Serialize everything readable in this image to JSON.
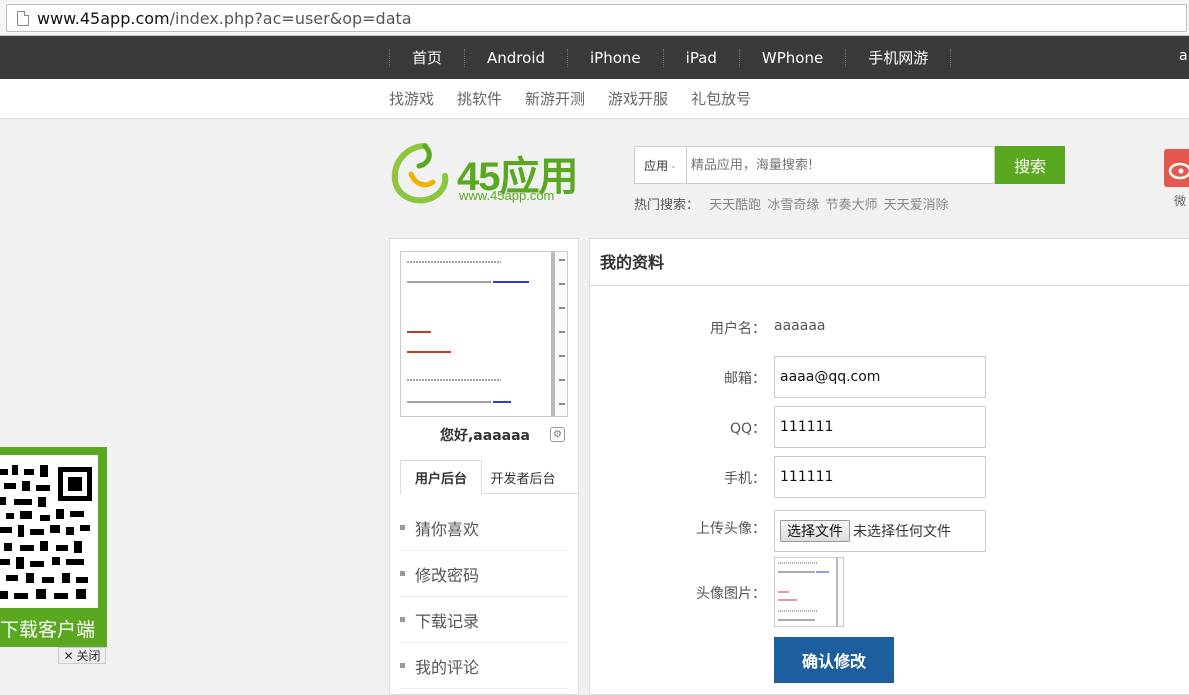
{
  "browser": {
    "url_host": "www.45app.com",
    "url_path": "/index.php?ac=user&op=data"
  },
  "top_nav": {
    "items": [
      "首页",
      "Android",
      "iPhone",
      "iPad",
      "WPhone",
      "手机网游"
    ],
    "right_text": "a"
  },
  "sub_nav": {
    "items": [
      "找游戏",
      "挑软件",
      "新游开测",
      "游戏开服",
      "礼包放号"
    ]
  },
  "logo": {
    "title": "45应用",
    "subtitle": "www.45app.com"
  },
  "search": {
    "category": "应用",
    "placeholder": "精品应用，海量搜索!",
    "button": "搜索",
    "hot_label": "热门搜索：",
    "hot_keywords": [
      "天天酷跑",
      "冰雪奇缘",
      "节奏大师",
      "天天爱消除"
    ]
  },
  "weibo": {
    "label": "微"
  },
  "sidebar": {
    "greeting": "您好,aaaaaa",
    "tabs": [
      "用户后台",
      "开发者后台"
    ],
    "menu": [
      "猜你喜欢",
      "修改密码",
      "下载记录",
      "我的评论"
    ]
  },
  "profile": {
    "title": "我的资料",
    "username_label": "用户名：",
    "username_value": "aaaaaa",
    "email_label": "邮箱：",
    "email_value": "aaaa@qq.com",
    "qq_label": "QQ：",
    "qq_value": "111111",
    "phone_label": "手机：",
    "phone_value": "111111",
    "upload_label": "上传头像：",
    "file_button": "选择文件",
    "file_status": "未选择任何文件",
    "avatar_label": "头像图片：",
    "submit": "确认修改"
  },
  "qr": {
    "label": "扫描下载客户端",
    "close": "关闭"
  },
  "colors": {
    "brand_green": "#5aa820",
    "submit_blue": "#1d5f9e",
    "nav_dark": "#3a3a3a"
  }
}
